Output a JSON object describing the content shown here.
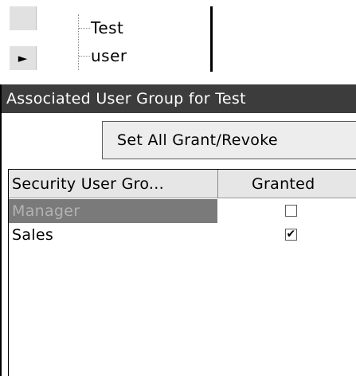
{
  "tree": {
    "nodes": [
      {
        "label": "Test",
        "selected": false
      },
      {
        "label": "user",
        "selected": true
      }
    ],
    "current_row_arrow": "►"
  },
  "panel": {
    "title": "Associated User Group for Test",
    "set_all_button": "Set All Grant/Revoke"
  },
  "grid": {
    "columns": [
      "Security User Gro...",
      "Granted"
    ],
    "rows": [
      {
        "name": "Manager",
        "granted": false,
        "selected": true
      },
      {
        "name": "Sales",
        "granted": true,
        "selected": false
      }
    ]
  },
  "colors": {
    "header_bg": "#3c3c3c",
    "selected_row_bg": "#7a7a7a"
  }
}
